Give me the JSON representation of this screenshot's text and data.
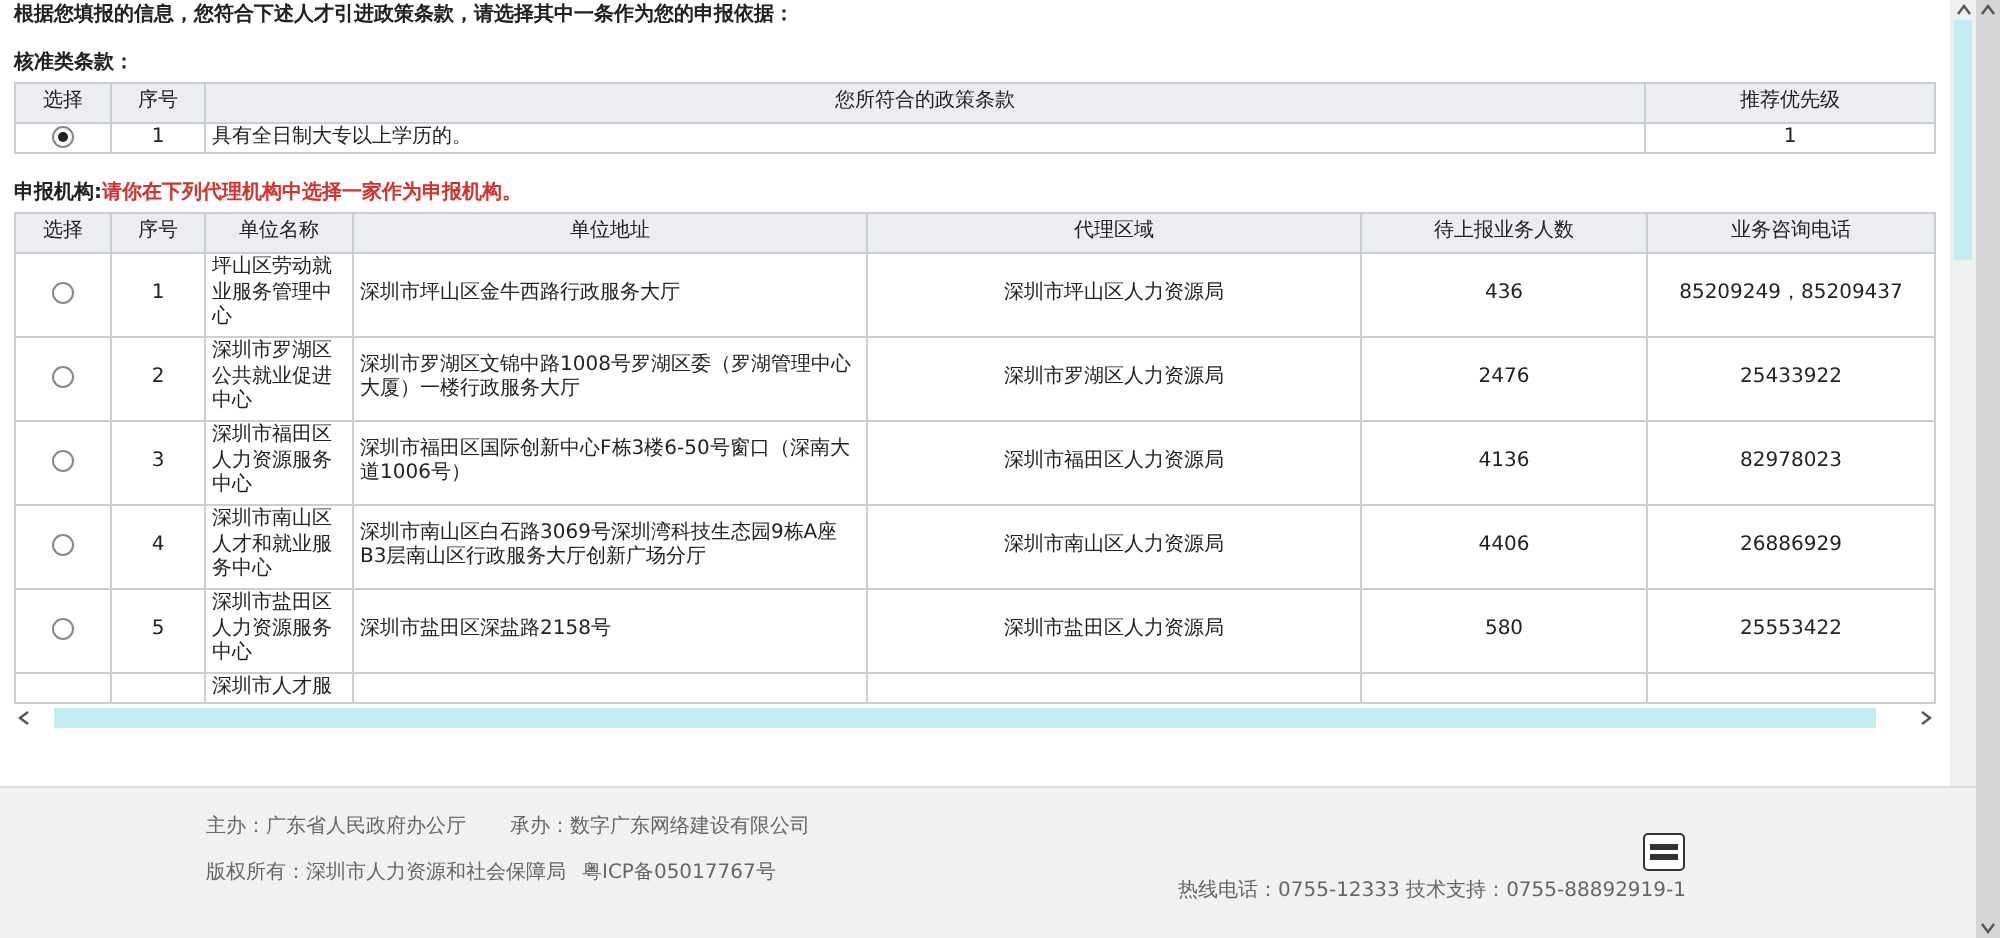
{
  "intro": "根据您填报的信息，您符合下述人才引进政策条款，请选择其中一条作为您的申报依据：",
  "policy_section": {
    "title": "核准类条款：",
    "columns": [
      "选择",
      "序号",
      "您所符合的政策条款",
      "推荐优先级"
    ],
    "rows": [
      {
        "selected": true,
        "index": "1",
        "clause": "具有全日制大专以上学历的。",
        "priority": "1"
      }
    ]
  },
  "agency_section": {
    "title": "申报机构:",
    "hint": "请你在下列代理机构中选择一家作为申报机构。",
    "columns": [
      "选择",
      "序号",
      "单位名称",
      "单位地址",
      "代理区域",
      "待上报业务人数",
      "业务咨询电话"
    ],
    "rows": [
      {
        "selected": false,
        "index": "1",
        "name": "坪山区劳动就业服务管理中心",
        "address": "深圳市坪山区金牛西路行政服务大厅",
        "region": "深圳市坪山区人力资源局",
        "pending": "436",
        "phone": "85209249，85209437"
      },
      {
        "selected": false,
        "index": "2",
        "name": "深圳市罗湖区公共就业促进中心",
        "address": "深圳市罗湖区文锦中路1008号罗湖区委（罗湖管理中心大厦）一楼行政服务大厅",
        "region": "深圳市罗湖区人力资源局",
        "pending": "2476",
        "phone": "25433922"
      },
      {
        "selected": false,
        "index": "3",
        "name": "深圳市福田区人力资源服务中心",
        "address": "深圳市福田区国际创新中心F栋3楼6-50号窗口（深南大道1006号）",
        "region": "深圳市福田区人力资源局",
        "pending": "4136",
        "phone": "82978023"
      },
      {
        "selected": false,
        "index": "4",
        "name": "深圳市南山区人才和就业服务中心",
        "address": "深圳市南山区白石路3069号深圳湾科技生态园9栋A座B3层南山区行政服务大厅创新广场分厅",
        "region": "深圳市南山区人力资源局",
        "pending": "4406",
        "phone": "26886929"
      },
      {
        "selected": false,
        "index": "5",
        "name": "深圳市盐田区人力资源服务中心",
        "address": "深圳市盐田区深盐路2158号",
        "region": "深圳市盐田区人力资源局",
        "pending": "580",
        "phone": "25553422"
      }
    ],
    "partial_row_name": "深圳市人才服"
  },
  "footer": {
    "host": "主办：广东省人民政府办公厅",
    "organizer": "承办：数字广东网络建设有限公司",
    "copyright": "版权所有：深圳市人力资源和社会保障局",
    "icp": "粤ICP备05017767号",
    "hotline": "热线电话：0755-12333 技术支持：0755-88892919-1"
  }
}
